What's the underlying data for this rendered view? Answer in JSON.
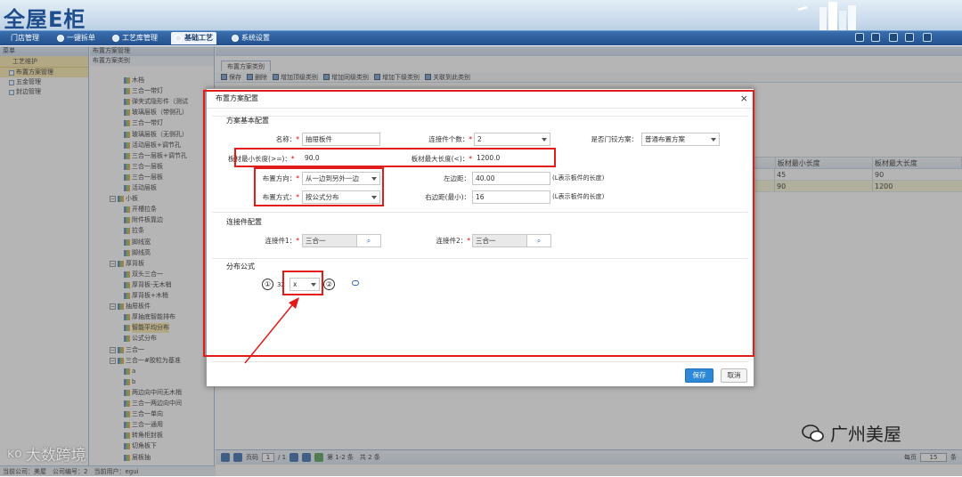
{
  "app": {
    "logo": "全屋E柜"
  },
  "menubar": {
    "tabs": [
      {
        "label": "门店管理"
      },
      {
        "label": "一键拆单"
      },
      {
        "label": "工艺库管理"
      },
      {
        "label": "基础工艺"
      },
      {
        "label": "系统设置"
      }
    ],
    "active_index": 3
  },
  "left_panel": {
    "header": "菜单",
    "section": "工艺维护",
    "items": [
      "布置方案管理",
      "五金管理",
      "封边管理"
    ],
    "selected_index": 0
  },
  "tree_panel": {
    "header": "布置方案类别",
    "rows": [
      {
        "label": "木档",
        "type": "leaf"
      },
      {
        "label": "三合一带灯",
        "type": "leaf"
      },
      {
        "label": "弹夹式隐形件（测试",
        "type": "leaf"
      },
      {
        "label": "玻璃层板（带侧孔）",
        "type": "leaf"
      },
      {
        "label": "三合一带灯",
        "type": "leaf"
      },
      {
        "label": "玻璃层板（无侧孔）",
        "type": "leaf"
      },
      {
        "label": "活动层板+调节孔",
        "type": "leaf"
      },
      {
        "label": "三合一层板+调节孔",
        "type": "leaf"
      },
      {
        "label": "三合一层板",
        "type": "leaf"
      },
      {
        "label": "三合一层板",
        "type": "leaf"
      },
      {
        "label": "活动层板",
        "type": "leaf"
      },
      {
        "label": "小板",
        "type": "group"
      },
      {
        "label": "开槽拉条",
        "type": "leaf"
      },
      {
        "label": "附件板靠边",
        "type": "leaf"
      },
      {
        "label": "拉条",
        "type": "leaf"
      },
      {
        "label": "脚线宽",
        "type": "leaf"
      },
      {
        "label": "脚线高",
        "type": "leaf"
      },
      {
        "label": "厚背板",
        "type": "group"
      },
      {
        "label": "双头三合一",
        "type": "leaf"
      },
      {
        "label": "厚背板-无木梢",
        "type": "leaf"
      },
      {
        "label": "厚背板+木梢",
        "type": "leaf"
      },
      {
        "label": "抽屉板件",
        "type": "group"
      },
      {
        "label": "厚抽底智能排布",
        "type": "leaf"
      },
      {
        "label": "智能平均分布",
        "type": "leaf",
        "selected": true
      },
      {
        "label": "公式分布",
        "type": "leaf"
      },
      {
        "label": "三合一",
        "type": "group"
      },
      {
        "label": "三合一#胶粒为基准",
        "type": "group"
      },
      {
        "label": "a",
        "type": "leaf"
      },
      {
        "label": "b",
        "type": "leaf"
      },
      {
        "label": "两边向中间无木梢",
        "type": "leaf"
      },
      {
        "label": "三合一两边向中间",
        "type": "leaf"
      },
      {
        "label": "三合一单向",
        "type": "leaf"
      },
      {
        "label": "三合一通用",
        "type": "leaf"
      },
      {
        "label": "转角柜封板",
        "type": "leaf"
      },
      {
        "label": "切角板下",
        "type": "leaf"
      },
      {
        "label": "层板抽",
        "type": "leaf"
      }
    ]
  },
  "main_panel": {
    "header": "布置方案管理",
    "tab": "布置方案类别",
    "toolbar": [
      "保存",
      "删除",
      "增加顶级类别",
      "增加同级类别",
      "增加下级类别",
      "关联到此类别"
    ],
    "grid": {
      "columns": [
        "板材最小长度",
        "板材最大长度"
      ],
      "rows": [
        [
          "45",
          "90"
        ],
        [
          "90",
          "1200"
        ]
      ],
      "selected_row": 1
    },
    "pager": {
      "page_label": "页码",
      "page": "1",
      "of": "/ 1",
      "summary": "第 1-2 条　共 2 条",
      "per_page_label": "每页",
      "per_page": "15",
      "unit": "条"
    }
  },
  "statusbar": "当前公司：美屋　公司编号：2　当前用户：egui",
  "dialog": {
    "title": "布置方案配置",
    "close": "×",
    "sections": {
      "basic": "方案基本配置",
      "connector": "连接件配置",
      "formula": "分布公式"
    },
    "fields": {
      "name": {
        "label": "名称：",
        "value": "抽屉板件"
      },
      "connector_count": {
        "label": "连接件个数：",
        "value": "2"
      },
      "door_hinge": {
        "label": "是否门铰方案：",
        "value": "普通布置方案"
      },
      "min_len": {
        "label": "板材最小长度(>=)：",
        "value": "90.0"
      },
      "max_len": {
        "label": "板材最大长度(<)：",
        "value": "1200.0"
      },
      "direction": {
        "label": "布置方向：",
        "value": "从一边到另外一边"
      },
      "left_margin": {
        "label": "左边距：",
        "value": "40.00",
        "hint": "(L表示板件的长度)"
      },
      "mode": {
        "label": "布置方式：",
        "value": "按公式分布"
      },
      "right_margin": {
        "label": "右边距(最小)：",
        "value": "16",
        "hint": "(L表示板件的长度)"
      },
      "connector1": {
        "label": "连接件1：",
        "value": "三合一"
      },
      "connector2": {
        "label": "连接件2：",
        "value": "三合一"
      },
      "formula_prefix": "32",
      "formula_op": "x"
    },
    "required_mark": "*",
    "save": "保存",
    "cancel": "取消",
    "markers": [
      "①",
      "②"
    ]
  },
  "watermarks": {
    "left": "大数跨境",
    "right": "广州美屋"
  },
  "colors": {
    "accent": "#2d88d8",
    "highlight": "#e21b1b",
    "menubar": "#22508d"
  }
}
